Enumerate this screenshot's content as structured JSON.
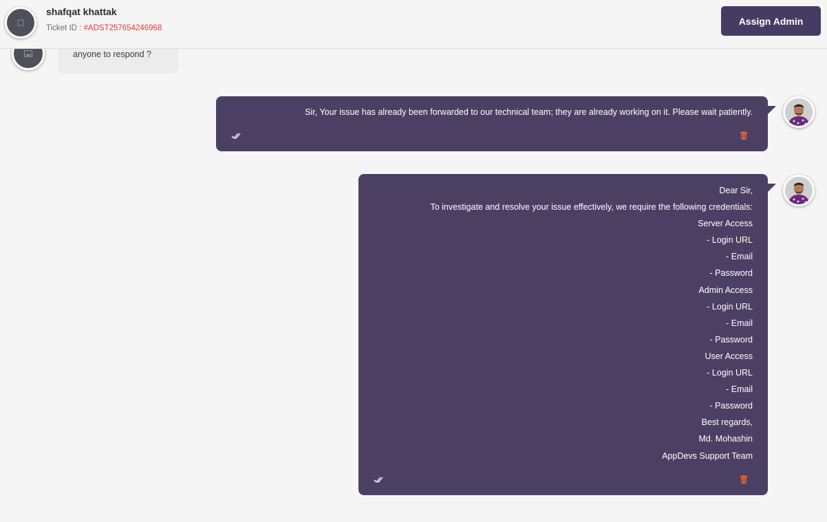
{
  "header": {
    "user_name": "shafqat khattak",
    "ticket_label": "Ticket ID : ",
    "ticket_id": "#ADST257654246968",
    "assign_button": "Assign Admin"
  },
  "messages": [
    {
      "direction": "incoming",
      "text": "anyone to respond ?"
    },
    {
      "direction": "outgoing",
      "text": "Sir, Your issue has already been forwarded to our technical team; they are already working on it. Please wait patiently."
    },
    {
      "direction": "outgoing",
      "lines": [
        "Dear Sir,",
        "To investigate and resolve your issue effectively, we require the following credentials:",
        "Server Access",
        "- Login URL",
        "- Email",
        "- Password",
        "Admin Access",
        "- Login URL",
        "- Email",
        "- Password",
        "User Access",
        "- Login URL",
        "- Email",
        "- Password",
        "Best regards,",
        "Md. Mohashin",
        "AppDevs Support Team"
      ]
    }
  ],
  "icons": {
    "read_receipt": "double-check-icon",
    "delete": "trash-icon",
    "avatar_placeholder": "image-icon"
  },
  "colors": {
    "bubble_outgoing": "#4b4064",
    "bubble_incoming": "#ececec",
    "button": "#453c63",
    "ticket_id": "#e23b3b",
    "trash": "#e8642c"
  }
}
